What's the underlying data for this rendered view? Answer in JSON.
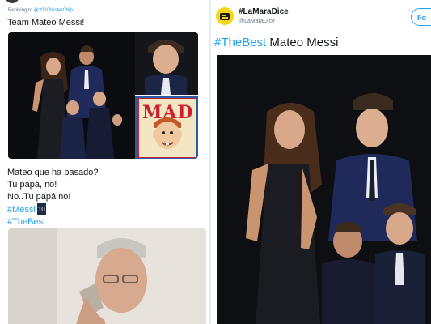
{
  "left_tweet": {
    "reply_prefix": "Replying to",
    "reply_handle": "@2010MisterChip",
    "text": "Team Mateo Messi!",
    "magazine_title": "MAD",
    "lines": [
      "Mateo que ha pasado?",
      "Tu papá, no!",
      "No..Tu papá no!"
    ],
    "hashtag_messi": "#Messi",
    "emoji_ten": "10",
    "hashtag_best": "#TheBest"
  },
  "right_tweet": {
    "account_name": "#LaMaraDice",
    "account_handle": "@LaMaraDice",
    "follow_label": "Fo",
    "hashtag": "#TheBest",
    "text": "Mateo Messi"
  },
  "colors": {
    "link": "#1da1f2",
    "logo_yellow": "#f6d417"
  }
}
